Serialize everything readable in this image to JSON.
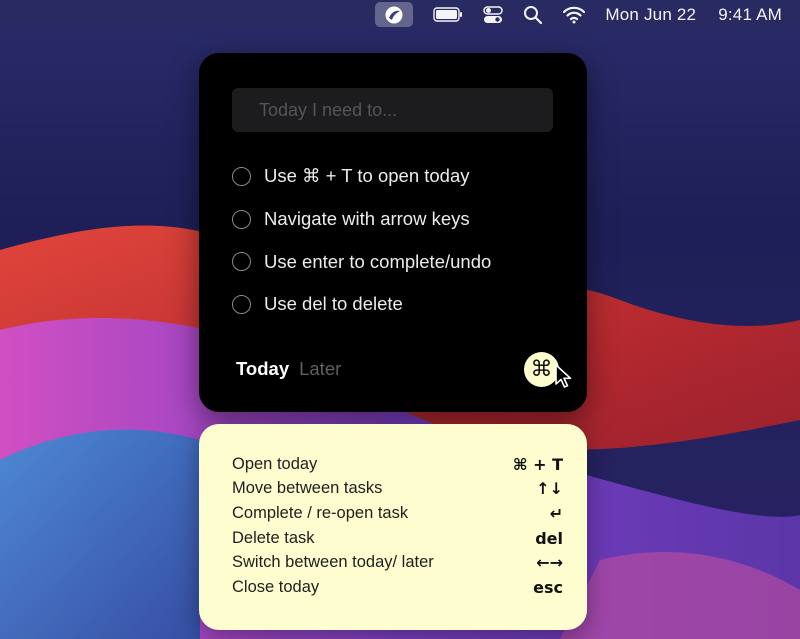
{
  "menubar": {
    "app_icon": "today-app-icon",
    "battery_icon": "battery-icon",
    "control_icon": "control-center-icon",
    "search_icon": "spotlight-search-icon",
    "wifi_icon": "wifi-icon",
    "date": "Mon Jun 22",
    "time": "9:41 AM"
  },
  "panel": {
    "input_placeholder": "Today I need to...",
    "input_value": "",
    "tasks": [
      {
        "label": "Use ⌘ + T to open today",
        "done": false
      },
      {
        "label": "Navigate with arrow keys",
        "done": false
      },
      {
        "label": "Use enter to complete/undo",
        "done": false
      },
      {
        "label": "Use del to delete",
        "done": false
      }
    ],
    "tabs": {
      "active": "Today",
      "inactive": "Later"
    },
    "cmd_button_label": "⌘"
  },
  "shortcuts": [
    {
      "label": "Open today",
      "key": "⌘ + T"
    },
    {
      "label": "Move between tasks",
      "key": "↑↓"
    },
    {
      "label": "Complete / re-open task",
      "key": "↵"
    },
    {
      "label": "Delete task",
      "key": "del"
    },
    {
      "label": "Switch between today/ later",
      "key": "←→"
    },
    {
      "label": "Close today",
      "key": "esc"
    }
  ],
  "colors": {
    "panel_bg": "#000000",
    "sheet_bg": "#fdfdcf",
    "accent_button": "#fdfdcf",
    "menubar_bg": "#282a60"
  }
}
